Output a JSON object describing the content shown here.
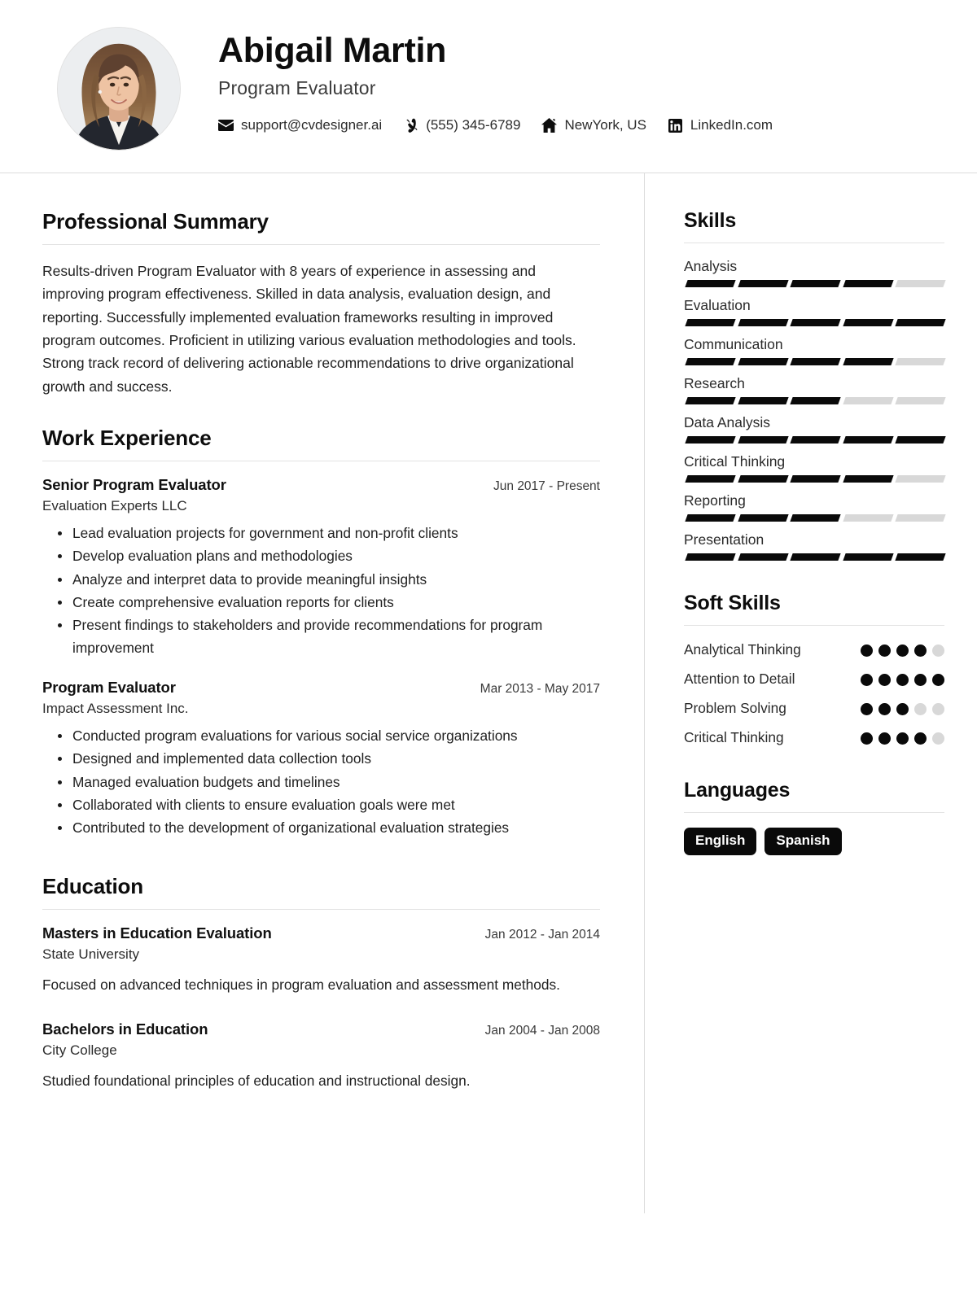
{
  "header": {
    "name": "Abigail Martin",
    "job_title": "Program Evaluator",
    "avatar_alt": "profile-photo",
    "contacts": [
      {
        "icon": "envelope-icon",
        "label": "support@cvdesigner.ai"
      },
      {
        "icon": "phone-icon",
        "label": "(555) 345-6789"
      },
      {
        "icon": "home-icon",
        "label": "NewYork, US"
      },
      {
        "icon": "linkedin-icon",
        "label": "LinkedIn.com"
      }
    ]
  },
  "main": {
    "summary": {
      "heading": "Professional Summary",
      "text": "Results-driven Program Evaluator with 8 years of experience in assessing and improving program effectiveness. Skilled in data analysis, evaluation design, and reporting. Successfully implemented evaluation frameworks resulting in improved program outcomes. Proficient in utilizing various evaluation methodologies and tools. Strong track record of delivering actionable recommendations to drive organizational growth and success."
    },
    "work": {
      "heading": "Work Experience",
      "entries": [
        {
          "title": "Senior Program Evaluator",
          "date": "Jun 2017 - Present",
          "org": "Evaluation Experts LLC",
          "bullets": [
            "Lead evaluation projects for government and non-profit clients",
            "Develop evaluation plans and methodologies",
            "Analyze and interpret data to provide meaningful insights",
            "Create comprehensive evaluation reports for clients",
            "Present findings to stakeholders and provide recommendations for program improvement"
          ]
        },
        {
          "title": "Program Evaluator",
          "date": "Mar 2013 - May 2017",
          "org": "Impact Assessment Inc.",
          "bullets": [
            "Conducted program evaluations for various social service organizations",
            "Designed and implemented data collection tools",
            "Managed evaluation budgets and timelines",
            "Collaborated with clients to ensure evaluation goals were met",
            "Contributed to the development of organizational evaluation strategies"
          ]
        }
      ]
    },
    "education": {
      "heading": "Education",
      "entries": [
        {
          "title": "Masters in Education Evaluation",
          "date": "Jan 2012 - Jan 2014",
          "org": "State University",
          "desc": "Focused on advanced techniques in program evaluation and assessment methods."
        },
        {
          "title": "Bachelors in Education",
          "date": "Jan 2004 - Jan 2008",
          "org": "City College",
          "desc": "Studied foundational principles of education and instructional design."
        }
      ]
    }
  },
  "sidebar": {
    "skills": {
      "heading": "Skills",
      "max": 5,
      "items": [
        {
          "name": "Analysis",
          "level": 4
        },
        {
          "name": "Evaluation",
          "level": 5
        },
        {
          "name": "Communication",
          "level": 4
        },
        {
          "name": "Research",
          "level": 3
        },
        {
          "name": "Data Analysis",
          "level": 5
        },
        {
          "name": "Critical Thinking",
          "level": 4
        },
        {
          "name": "Reporting",
          "level": 3
        },
        {
          "name": "Presentation",
          "level": 5
        }
      ]
    },
    "soft_skills": {
      "heading": "Soft Skills",
      "max": 5,
      "items": [
        {
          "name": "Analytical Thinking",
          "level": 4
        },
        {
          "name": "Attention to Detail",
          "level": 5
        },
        {
          "name": "Problem Solving",
          "level": 3
        },
        {
          "name": "Critical Thinking",
          "level": 4
        }
      ]
    },
    "languages": {
      "heading": "Languages",
      "items": [
        "English",
        "Spanish"
      ]
    }
  },
  "colors": {
    "text": "#1a1a1a",
    "accent_filled": "#0a0a0a",
    "accent_empty": "#d8d8d8",
    "rule": "#e3e3e3"
  }
}
